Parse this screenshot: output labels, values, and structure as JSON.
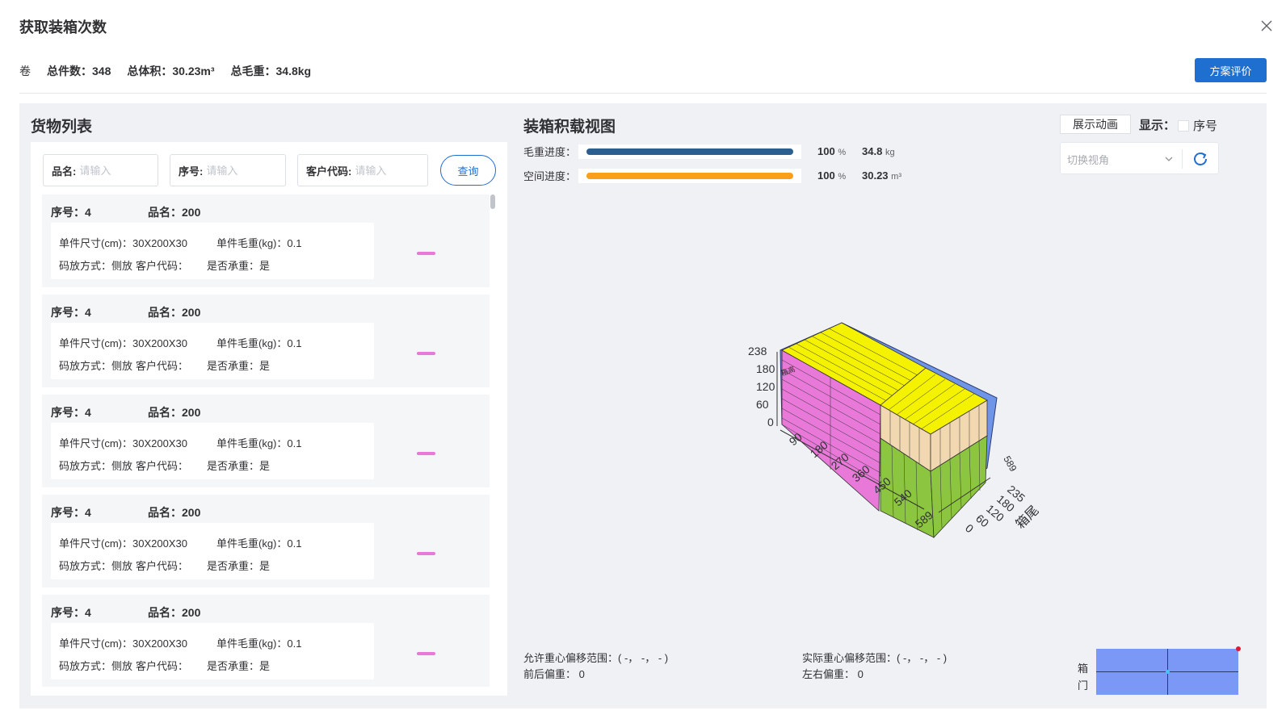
{
  "dialog": {
    "title": "获取装箱次数"
  },
  "summary": {
    "prefix": "卷",
    "count_label": "总件数：",
    "count": "348",
    "volume_label": "总体积：",
    "volume": "30.23m³",
    "weight_label": "总毛重：",
    "weight": "34.8kg"
  },
  "eval_button": "方案评价",
  "list": {
    "title": "货物列表",
    "search": {
      "name_label": "品名:",
      "name_placeholder": "请输入",
      "seq_label": "序号:",
      "seq_placeholder": "请输入",
      "cust_label": "客户代码:",
      "cust_placeholder": "请输入",
      "query_label": "查询"
    },
    "items": [
      {
        "seq": "序号：4",
        "name": "品名：200",
        "size": "单件尺寸(cm)：30X200X30",
        "gross": "单件毛重(kg)：0.1",
        "stack": "码放方式：侧放",
        "cust": "客户代码：",
        "bear": "是否承重：是",
        "color": "#e879d9"
      },
      {
        "seq": "序号：4",
        "name": "品名：200",
        "size": "单件尺寸(cm)：30X200X30",
        "gross": "单件毛重(kg)：0.1",
        "stack": "码放方式：侧放",
        "cust": "客户代码：",
        "bear": "是否承重：是",
        "color": "#e879d9"
      },
      {
        "seq": "序号：4",
        "name": "品名：200",
        "size": "单件尺寸(cm)：30X200X30",
        "gross": "单件毛重(kg)：0.1",
        "stack": "码放方式：侧放",
        "cust": "客户代码：",
        "bear": "是否承重：是",
        "color": "#e879d9"
      },
      {
        "seq": "序号：4",
        "name": "品名：200",
        "size": "单件尺寸(cm)：30X200X30",
        "gross": "单件毛重(kg)：0.1",
        "stack": "码放方式：侧放",
        "cust": "客户代码：",
        "bear": "是否承重：是",
        "color": "#e879d9"
      },
      {
        "seq": "序号：4",
        "name": "品名：200",
        "size": "单件尺寸(cm)：30X200X30",
        "gross": "单件毛重(kg)：0.1",
        "stack": "码放方式：侧放",
        "cust": "客户代码：",
        "bear": "是否承重：是",
        "color": "#e879d9"
      }
    ]
  },
  "view": {
    "title": "装箱积载视图",
    "weight_progress": {
      "label": "毛重进度：",
      "percent": 100,
      "percent_unit": "%",
      "value": "34.8",
      "unit": "kg",
      "color": "#2a5f8f"
    },
    "space_progress": {
      "label": "空间进度：",
      "percent": 100,
      "percent_unit": "%",
      "value": "30.23",
      "unit": "m³",
      "color": "#f9a01b"
    },
    "anim_button": "展示动画",
    "show_label": "显示：",
    "seq_checkbox": "序号",
    "angle_placeholder": "切换视角",
    "axis": {
      "height_ticks": [
        "238",
        "180",
        "120",
        "60",
        "0"
      ],
      "length_ticks": [
        "90",
        "180",
        "270",
        "360",
        "450",
        "540",
        "589"
      ],
      "width_ticks": [
        "0",
        "60",
        "120",
        "180",
        "235"
      ],
      "length_end": "589",
      "width_label": "箱尾",
      "height_label": "箱高"
    },
    "allowed_cg": "允许重心偏移范围：( -， -， - )",
    "actual_cg": "实际重心偏移范围：( -， -， - )",
    "front_back": "前后偏重：  0",
    "left_right": "左右偏重：  0",
    "door_label_1": "箱",
    "door_label_2": "门"
  }
}
